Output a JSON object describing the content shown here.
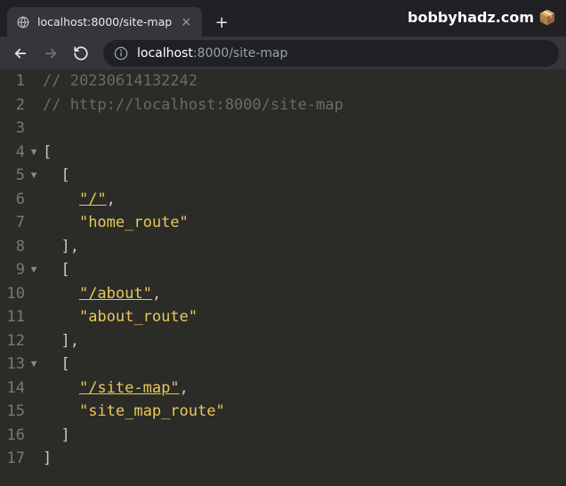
{
  "chrome": {
    "tab_title": "localhost:8000/site-map",
    "tab_close_label": "×",
    "new_tab_label": "+",
    "brand": "bobbyhadz.com",
    "brand_icon": "📦"
  },
  "toolbar": {
    "back": "←",
    "forward": "→",
    "reload": "⟳",
    "info_icon": "ⓘ",
    "url_host": "localhost",
    "url_port": ":8000",
    "url_path": "/site-map"
  },
  "code": {
    "fold_marker": "▼",
    "lines": [
      {
        "n": "1",
        "fold": false,
        "indent": 0,
        "parts": [
          {
            "t": "comment",
            "v": "// 20230614132242"
          }
        ]
      },
      {
        "n": "2",
        "fold": false,
        "indent": 0,
        "parts": [
          {
            "t": "comment",
            "v": "// http://localhost:8000/site-map"
          }
        ]
      },
      {
        "n": "3",
        "fold": false,
        "indent": 0,
        "parts": []
      },
      {
        "n": "4",
        "fold": true,
        "indent": 0,
        "parts": [
          {
            "t": "punct",
            "v": "["
          }
        ]
      },
      {
        "n": "5",
        "fold": true,
        "indent": 1,
        "parts": [
          {
            "t": "punct",
            "v": "["
          }
        ]
      },
      {
        "n": "6",
        "fold": false,
        "indent": 2,
        "parts": [
          {
            "t": "url",
            "v": "\"/\""
          },
          {
            "t": "punct",
            "v": ","
          }
        ]
      },
      {
        "n": "7",
        "fold": false,
        "indent": 2,
        "parts": [
          {
            "t": "str",
            "v": "\"home_route\""
          }
        ]
      },
      {
        "n": "8",
        "fold": false,
        "indent": 1,
        "parts": [
          {
            "t": "punct",
            "v": "]"
          },
          {
            "t": "punct",
            "v": ","
          }
        ]
      },
      {
        "n": "9",
        "fold": true,
        "indent": 1,
        "parts": [
          {
            "t": "punct",
            "v": "["
          }
        ]
      },
      {
        "n": "10",
        "fold": false,
        "indent": 2,
        "parts": [
          {
            "t": "url",
            "v": "\"/about\""
          },
          {
            "t": "punct",
            "v": ","
          }
        ]
      },
      {
        "n": "11",
        "fold": false,
        "indent": 2,
        "parts": [
          {
            "t": "str",
            "v": "\"about_route\""
          }
        ]
      },
      {
        "n": "12",
        "fold": false,
        "indent": 1,
        "parts": [
          {
            "t": "punct",
            "v": "]"
          },
          {
            "t": "punct",
            "v": ","
          }
        ]
      },
      {
        "n": "13",
        "fold": true,
        "indent": 1,
        "parts": [
          {
            "t": "punct",
            "v": "["
          }
        ]
      },
      {
        "n": "14",
        "fold": false,
        "indent": 2,
        "parts": [
          {
            "t": "url",
            "v": "\"/site-map\""
          },
          {
            "t": "punct",
            "v": ","
          }
        ]
      },
      {
        "n": "15",
        "fold": false,
        "indent": 2,
        "parts": [
          {
            "t": "str",
            "v": "\"site_map_route\""
          }
        ]
      },
      {
        "n": "16",
        "fold": false,
        "indent": 1,
        "parts": [
          {
            "t": "punct",
            "v": "]"
          }
        ]
      },
      {
        "n": "17",
        "fold": false,
        "indent": 0,
        "parts": [
          {
            "t": "punct",
            "v": "]"
          }
        ]
      }
    ]
  }
}
